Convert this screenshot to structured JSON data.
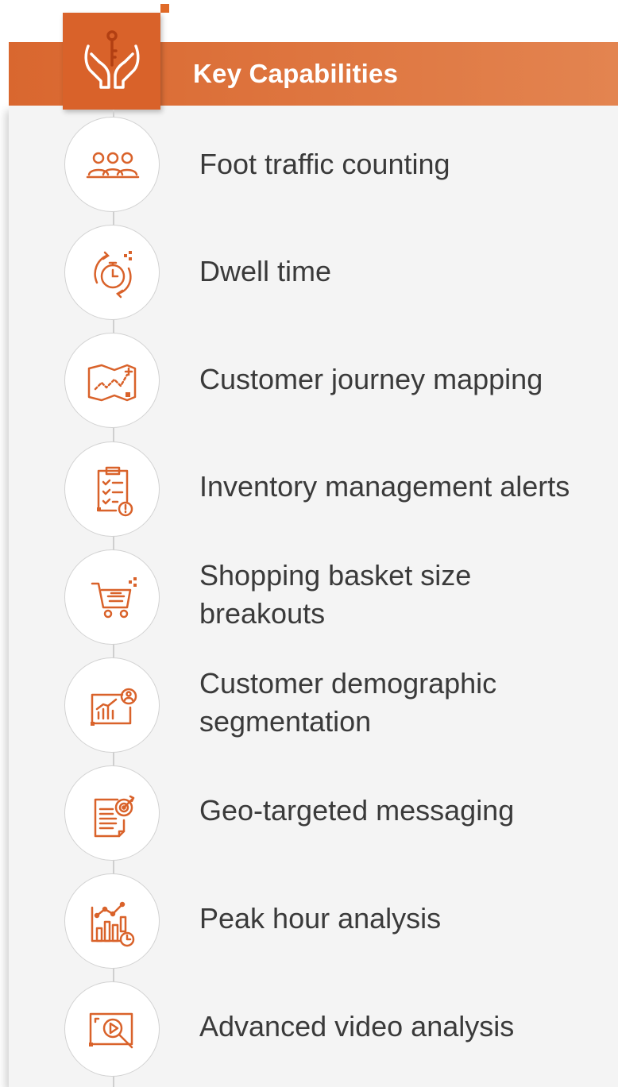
{
  "header": {
    "title": "Key Capabilities",
    "icon": "hands-key-icon"
  },
  "colors": {
    "accent": "#d9622a",
    "accent_light": "#e38450",
    "text": "#3a3a3a",
    "card_background": "#f4f4f4"
  },
  "capabilities": [
    {
      "label": "Foot traffic counting",
      "icon": "people-group-icon"
    },
    {
      "label": "Dwell time",
      "icon": "stopwatch-icon"
    },
    {
      "label": "Customer journey mapping",
      "icon": "map-route-icon"
    },
    {
      "label": "Inventory management alerts",
      "icon": "clipboard-checklist-alert-icon"
    },
    {
      "label": "Shopping basket size breakouts",
      "icon": "shopping-cart-icon"
    },
    {
      "label": "Customer demographic segmentation",
      "icon": "chart-user-icon"
    },
    {
      "label": "Geo-targeted messaging",
      "icon": "document-target-icon"
    },
    {
      "label": "Peak hour analysis",
      "icon": "bar-chart-clock-icon"
    },
    {
      "label": "Advanced video analysis",
      "icon": "video-magnify-icon"
    }
  ]
}
